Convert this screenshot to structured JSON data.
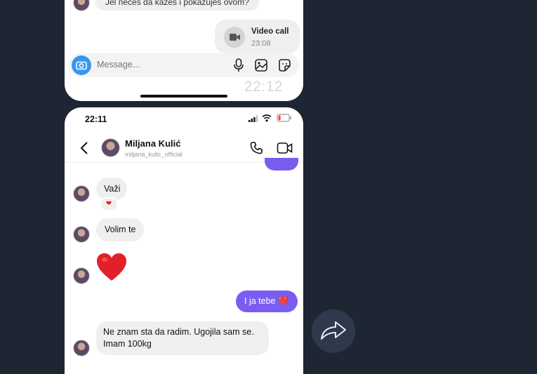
{
  "top_screen": {
    "partial_message": "Jel nećeš da kažeš i pokazuješ ovom?",
    "video_call": {
      "title": "Video call",
      "time": "23:08"
    },
    "composer": {
      "placeholder": "Message..."
    },
    "overlay_time": "22:12"
  },
  "bottom_screen": {
    "status_bar": {
      "time": "22:11"
    },
    "header": {
      "name": "Miljana Kulić",
      "handle": "miljana_kulic_official"
    },
    "messages": [
      {
        "from": "them",
        "text": "Važi",
        "reaction": "❤"
      },
      {
        "from": "them",
        "text": "Volim te"
      },
      {
        "from": "them",
        "text": "❤️"
      },
      {
        "from": "me",
        "text": "I ja tebe ❤️"
      },
      {
        "from": "them",
        "text": "Ne znam sta da radim. Ugojila sam se. Imam 100kg"
      }
    ]
  },
  "colors": {
    "accent_purple": "#7b5cf0",
    "camera_blue": "#3897f0",
    "background": "#1e2633",
    "heart_red": "#e0202a"
  },
  "icons": [
    "video-camera-icon",
    "camera-icon",
    "microphone-icon",
    "gallery-icon",
    "sticker-icon",
    "back-chevron-icon",
    "phone-icon",
    "video-icon",
    "share-arrow-icon"
  ]
}
